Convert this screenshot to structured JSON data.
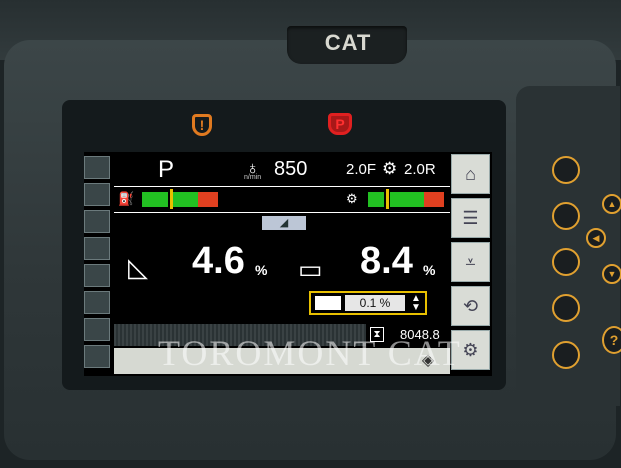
{
  "brand": {
    "logo_text": "CAT"
  },
  "indicators": {
    "warning_icon": "warning-lamp-icon",
    "park_icon": "parking-brake-icon",
    "warning_color": "#e07a20",
    "park_color": "#e02020",
    "warning_glyph": "!",
    "park_glyph": "P"
  },
  "status": {
    "gear": "P",
    "engine_speed": "850",
    "engine_speed_unit": "n/min",
    "speed_forward": "2.0F",
    "speed_reverse": "2.0R"
  },
  "gauges": {
    "left_icon": "fuel-gauge-icon",
    "right_icon": "transmission-temp-icon",
    "left_segments": [
      "#22c022",
      "#22c022",
      "#22c022",
      "#e04020"
    ],
    "right_segments": [
      "#22c022",
      "#22c022",
      "#22c022",
      "#e04020"
    ]
  },
  "blade": {
    "left_value": "4.6",
    "left_unit": "%",
    "right_value": "8.4",
    "right_unit": "%",
    "selected_value": "0.1 %"
  },
  "hours": {
    "value": "8048.8"
  },
  "watermark": "TOROMONT CAT",
  "right_buttons": [
    "home-icon",
    "menu-icon",
    "blade-icon",
    "rotate-icon",
    "settings-icon"
  ],
  "colors": {
    "accent_yellow": "#e8c000",
    "key_orange": "#e0a030"
  }
}
